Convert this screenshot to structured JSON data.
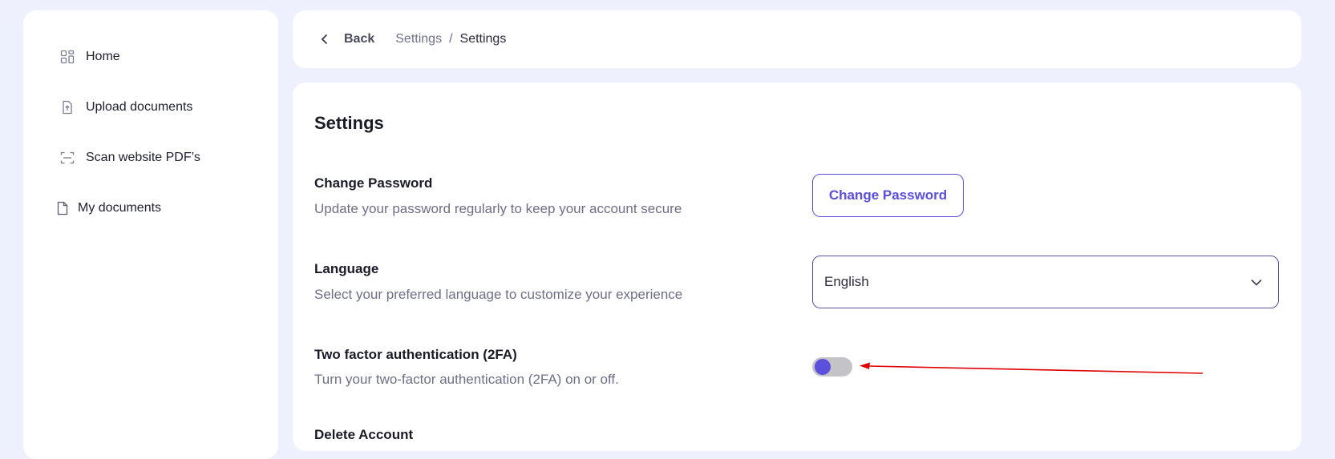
{
  "sidebar": {
    "items": [
      {
        "label": "Home",
        "icon": "grid-icon"
      },
      {
        "label": "Upload documents",
        "icon": "upload-file-icon"
      },
      {
        "label": "Scan website PDF’s",
        "icon": "scan-icon"
      },
      {
        "label": "My documents",
        "icon": "document-icon"
      }
    ]
  },
  "header": {
    "back_label": "Back",
    "breadcrumb": [
      "Settings",
      "Settings"
    ],
    "separator": "/"
  },
  "settings": {
    "title": "Settings",
    "change_password": {
      "title": "Change Password",
      "description": "Update your password regularly to keep your account secure",
      "button_label": "Change Password"
    },
    "language": {
      "title": "Language",
      "description": "Select your preferred language to customize your experience",
      "selected": "English"
    },
    "two_factor": {
      "title": "Two factor authentication (2FA)",
      "description": "Turn your two-factor authentication (2FA) on or off.",
      "enabled": false
    },
    "delete_account": {
      "title": "Delete Account"
    }
  },
  "colors": {
    "accent": "#5b4fdc",
    "background": "#eef0fd",
    "annotation": "#e00000"
  }
}
